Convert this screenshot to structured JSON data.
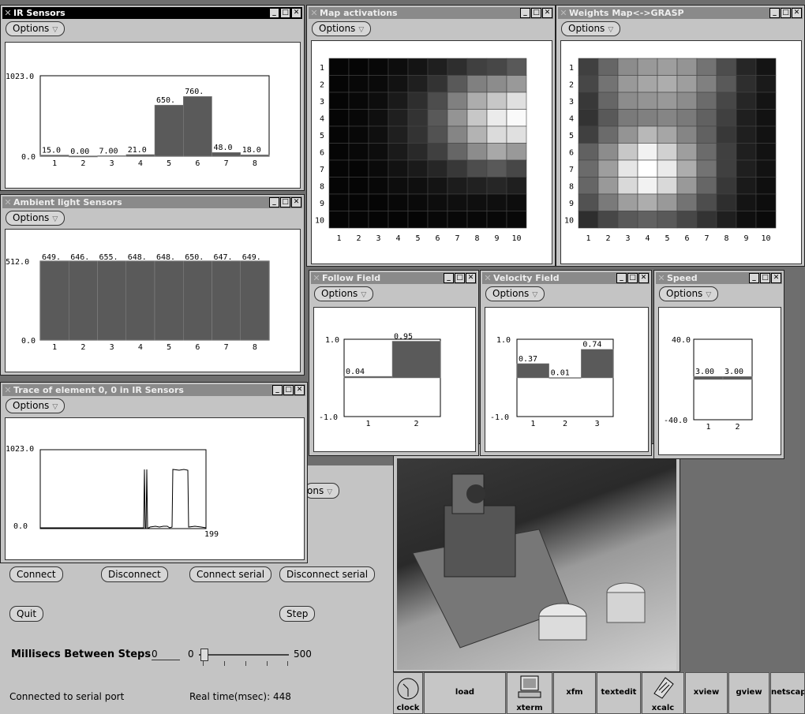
{
  "options_label": "Options",
  "ir_sensors": {
    "title": "IR Sensors",
    "chart_data": {
      "type": "bar",
      "categories": [
        "1",
        "2",
        "3",
        "4",
        "5",
        "6",
        "7",
        "8"
      ],
      "values": [
        15,
        0,
        7,
        21,
        650,
        760,
        48,
        18
      ],
      "labels": [
        "15.0",
        "0.00",
        "7.00",
        "21.0",
        "650.",
        "760.",
        "48.0",
        "18.0"
      ],
      "ylim": [
        0,
        1023
      ],
      "ytick_top": "1023.0",
      "ytick_bottom": "0.0"
    }
  },
  "ambient": {
    "title": "Ambient light Sensors",
    "chart_data": {
      "type": "bar",
      "categories": [
        "1",
        "2",
        "3",
        "4",
        "5",
        "6",
        "7",
        "8"
      ],
      "values": [
        649,
        646,
        655,
        648,
        648,
        650,
        647,
        649
      ],
      "labels": [
        "649.",
        "646.",
        "655.",
        "648.",
        "648.",
        "650.",
        "647.",
        "649."
      ],
      "ylim": [
        0,
        512
      ],
      "ytick_top": "512.0",
      "ytick_bottom": "0.0"
    }
  },
  "trace": {
    "title": "Trace of element 0, 0 in IR Sensors",
    "ytick_top": "1023.0",
    "ytick_bottom": "0.0",
    "xlabel_end": "199"
  },
  "map_activations": {
    "title": "Map activations",
    "chart_data": {
      "type": "heatmap",
      "rows": [
        "1",
        "2",
        "3",
        "4",
        "5",
        "6",
        "7",
        "8",
        "9",
        "10"
      ],
      "cols": [
        "1",
        "2",
        "3",
        "4",
        "5",
        "6",
        "7",
        "8",
        "9",
        "10"
      ],
      "values": [
        [
          0.02,
          0.02,
          0.03,
          0.05,
          0.08,
          0.12,
          0.18,
          0.25,
          0.28,
          0.35
        ],
        [
          0.02,
          0.03,
          0.04,
          0.07,
          0.12,
          0.2,
          0.35,
          0.5,
          0.55,
          0.6
        ],
        [
          0.02,
          0.03,
          0.05,
          0.1,
          0.18,
          0.3,
          0.5,
          0.68,
          0.78,
          0.88
        ],
        [
          0.02,
          0.03,
          0.06,
          0.12,
          0.2,
          0.35,
          0.58,
          0.78,
          0.92,
          0.98
        ],
        [
          0.02,
          0.03,
          0.06,
          0.12,
          0.2,
          0.32,
          0.52,
          0.7,
          0.86,
          0.88
        ],
        [
          0.02,
          0.03,
          0.05,
          0.1,
          0.16,
          0.25,
          0.4,
          0.55,
          0.66,
          0.6
        ],
        [
          0.02,
          0.02,
          0.04,
          0.07,
          0.1,
          0.15,
          0.22,
          0.3,
          0.35,
          0.28
        ],
        [
          0.02,
          0.02,
          0.03,
          0.05,
          0.06,
          0.08,
          0.11,
          0.13,
          0.15,
          0.12
        ],
        [
          0.02,
          0.02,
          0.02,
          0.03,
          0.04,
          0.05,
          0.06,
          0.06,
          0.06,
          0.05
        ],
        [
          0.02,
          0.02,
          0.02,
          0.02,
          0.02,
          0.03,
          0.03,
          0.03,
          0.03,
          0.03
        ]
      ]
    }
  },
  "weights_map": {
    "title": "Weights Map<->GRASP",
    "chart_data": {
      "type": "heatmap",
      "rows": [
        "1",
        "2",
        "3",
        "4",
        "5",
        "6",
        "7",
        "8",
        "9",
        "10"
      ],
      "cols": [
        "1",
        "2",
        "3",
        "4",
        "5",
        "6",
        "7",
        "8",
        "9",
        "10"
      ],
      "values": [
        [
          0.25,
          0.4,
          0.55,
          0.6,
          0.62,
          0.58,
          0.45,
          0.3,
          0.15,
          0.08
        ],
        [
          0.28,
          0.45,
          0.6,
          0.65,
          0.68,
          0.62,
          0.5,
          0.35,
          0.18,
          0.1
        ],
        [
          0.22,
          0.4,
          0.55,
          0.58,
          0.6,
          0.55,
          0.42,
          0.28,
          0.15,
          0.08
        ],
        [
          0.2,
          0.35,
          0.48,
          0.5,
          0.52,
          0.48,
          0.38,
          0.25,
          0.12,
          0.07
        ],
        [
          0.25,
          0.42,
          0.58,
          0.72,
          0.65,
          0.52,
          0.38,
          0.22,
          0.12,
          0.07
        ],
        [
          0.38,
          0.55,
          0.78,
          0.95,
          0.82,
          0.62,
          0.42,
          0.25,
          0.12,
          0.07
        ],
        [
          0.42,
          0.62,
          0.9,
          1.0,
          0.92,
          0.68,
          0.45,
          0.25,
          0.12,
          0.07
        ],
        [
          0.4,
          0.6,
          0.85,
          0.95,
          0.85,
          0.6,
          0.4,
          0.22,
          0.1,
          0.06
        ],
        [
          0.32,
          0.48,
          0.62,
          0.68,
          0.6,
          0.45,
          0.3,
          0.18,
          0.08,
          0.05
        ],
        [
          0.18,
          0.28,
          0.35,
          0.38,
          0.35,
          0.28,
          0.2,
          0.12,
          0.06,
          0.04
        ]
      ]
    }
  },
  "follow_field": {
    "title": "Follow Field",
    "chart_data": {
      "type": "bar",
      "categories": [
        "1",
        "2"
      ],
      "values": [
        0.04,
        0.95
      ],
      "labels": [
        "0.04",
        "0.95"
      ],
      "ylim": [
        -1,
        1
      ],
      "ytick_top": "1.0",
      "ytick_bottom": "-1.0"
    }
  },
  "velocity_field": {
    "title": "Velocity Field",
    "chart_data": {
      "type": "bar",
      "categories": [
        "1",
        "2",
        "3"
      ],
      "values": [
        0.37,
        0.01,
        0.74
      ],
      "labels": [
        "0.37",
        "0.01",
        "0.74"
      ],
      "ylim": [
        -1,
        1
      ],
      "ytick_top": "1.0",
      "ytick_bottom": "-1.0"
    }
  },
  "speed": {
    "title": "Speed",
    "chart_data": {
      "type": "bar",
      "categories": [
        "1",
        "2"
      ],
      "values": [
        3,
        3
      ],
      "labels": [
        "3.00",
        "3.00"
      ],
      "ylim": [
        -40,
        40
      ],
      "ytick_top": "40.0",
      "ytick_bottom": "-40.0"
    }
  },
  "control": {
    "options_partial": "ons",
    "connect": "Connect",
    "disconnect": "Disconnect",
    "connect_serial": "Connect serial",
    "disconnect_serial": "Disconnect serial",
    "quit": "Quit",
    "step": "Step",
    "ms_label": "Millisecs Between Steps",
    "ms_value": "0",
    "slider_min": "0",
    "slider_max": "500",
    "slider_value": 0,
    "status": "Connected to serial port",
    "realtime": "Real time(msec): 448"
  },
  "taskbar": {
    "clock": "clock",
    "load": "load",
    "xterm": "xterm",
    "xfm": "xfm",
    "textedit": "textedit",
    "xcalc": "xcalc",
    "xview": "xview",
    "gview": "gview",
    "netscape": "netscap"
  }
}
